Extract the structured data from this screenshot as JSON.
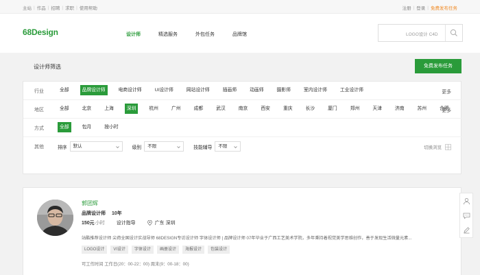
{
  "topbar": {
    "left_links": [
      "主站",
      "作品",
      "招聘",
      "求职",
      "使用帮助"
    ],
    "register": "注册",
    "login": "登录",
    "publish": "免费发布任务"
  },
  "header": {
    "logo": "68Design",
    "nav": [
      "设计师",
      "精选服务",
      "外包任务",
      "品牌馆"
    ],
    "active_nav": 0,
    "search_hint": "LOGO设计  C4D"
  },
  "title": {
    "text": "设计师筛选",
    "publish_button": "免费发布任务"
  },
  "filters": {
    "industry": {
      "label": "行业",
      "options": [
        "全部",
        "品牌设计师",
        "电商设计师",
        "UI设计师",
        "网站设计师",
        "插画师",
        "动画师",
        "摄影师",
        "室内设计师",
        "工业设计师"
      ],
      "selected": 1,
      "more": "更多"
    },
    "region": {
      "label": "地区",
      "options": [
        "全部",
        "北京",
        "上海",
        "深圳",
        "杭州",
        "广州",
        "成都",
        "武汉",
        "南京",
        "西安",
        "重庆",
        "长沙",
        "厦门",
        "郑州",
        "天津",
        "济南",
        "苏州",
        "合肥"
      ],
      "selected": 3,
      "more": "更多"
    },
    "mode": {
      "label": "方式",
      "options": [
        "全部",
        "包月",
        "按小时"
      ],
      "selected": 0
    },
    "other": {
      "label": "其他",
      "sort_label": "排序",
      "sort_value": "默认",
      "level_label": "级别",
      "level_value": "不限",
      "tutor_label": "技能辅导",
      "tutor_value": "不限",
      "switch_view": "切换浏览"
    }
  },
  "designer": {
    "name": "郭团辉",
    "role": "品牌设计师",
    "years": "10年",
    "price": "150元",
    "price_unit": "小时",
    "position": "设计指导",
    "location": "广东 深圳",
    "bio": "站酷推荐设计师 尖荷全国设计实战导师 68DESIGN专访设计师 字体设计师 | 品牌设计师 07年毕业于广西工艺美术学院，多年秉持着视觉美学思维创作，善于发现生活微量元素...",
    "tags": [
      "LOGO设计",
      "VI设计",
      "字体设计",
      "画册设计",
      "海报设计",
      "包装设计"
    ],
    "work_time": "可工作时间  工作日(20：00-22：00) 周末(9：00-18：00)"
  },
  "colors": {
    "brand_green": "#2a9b3a",
    "accent_orange": "#f08a24"
  }
}
